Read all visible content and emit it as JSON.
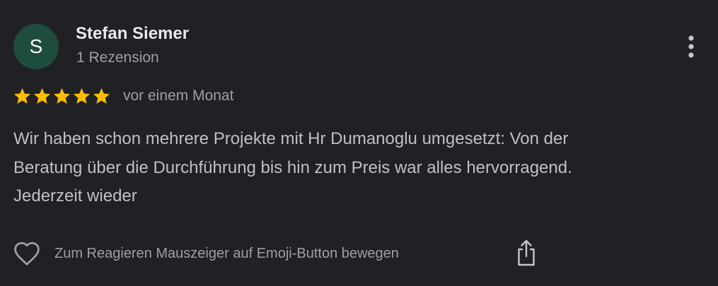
{
  "review": {
    "avatar_initial": "S",
    "author_name": "Stefan Siemer",
    "review_count": "1 Rezension",
    "rating": 5,
    "rating_max": 5,
    "date": "vor einem Monat",
    "text_lines": [
      "Wir haben schon mehrere Projekte mit Hr Dumanoglu umgesetzt: Von der",
      "Beratung über die Durchführung bis hin zum Preis war alles hervorragend.",
      "Jederzeit wieder"
    ],
    "react_hint": "Zum Reagieren Mauszeiger auf Emoji-Button bewegen"
  },
  "icons": {
    "more": "more-vert-icon",
    "star": "star-icon",
    "like": "heart-outline-icon",
    "share": "share-icon"
  },
  "colors": {
    "background": "#202124",
    "avatar_bg": "#1e4d3f",
    "star": "#fbbc04",
    "primary_text": "#e8eaed",
    "secondary_text": "#9aa0a6",
    "body_text": "#bdc1c6"
  }
}
